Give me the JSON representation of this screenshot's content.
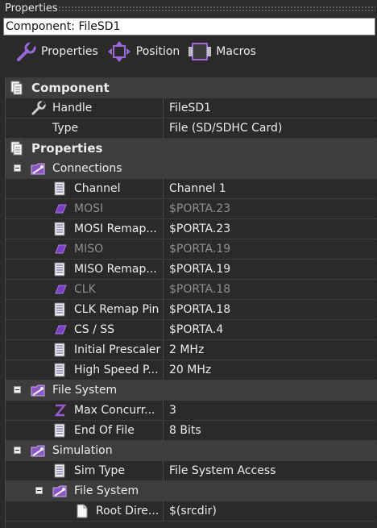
{
  "panel": {
    "title": "Properties"
  },
  "component_field": {
    "text": "Component: FileSD1"
  },
  "toolbar": {
    "properties_label": "Properties",
    "position_label": "Position",
    "macros_label": "Macros"
  },
  "sections": {
    "component": {
      "label": "Component",
      "handle": {
        "name": "Handle",
        "value": "FileSD1"
      },
      "type": {
        "name": "Type",
        "value": "File (SD/SDHC Card)"
      }
    },
    "properties": {
      "label": "Properties"
    },
    "connections": {
      "label": "Connections",
      "channel": {
        "name": "Channel",
        "value": "Channel 1"
      },
      "mosi": {
        "name": "MOSI",
        "value": "$PORTA.23"
      },
      "mosi_remap": {
        "name": "MOSI Remap...",
        "value": "$PORTA.23"
      },
      "miso": {
        "name": "MISO",
        "value": "$PORTA.19"
      },
      "miso_remap": {
        "name": "MISO Remap...",
        "value": "$PORTA.19"
      },
      "clk": {
        "name": "CLK",
        "value": "$PORTA.18"
      },
      "clk_remap": {
        "name": "CLK Remap Pin",
        "value": "$PORTA.18"
      },
      "cs_ss": {
        "name": "CS / SS",
        "value": "$PORTA.4"
      },
      "initial_prescaler": {
        "name": "Initial Prescaler",
        "value": "2 MHz"
      },
      "high_speed": {
        "name": "High Speed P...",
        "value": "20 MHz"
      }
    },
    "file_system": {
      "label": "File System",
      "max_concurrent": {
        "name": "Max Concurr...",
        "value": "3"
      },
      "end_of_file": {
        "name": "End Of File",
        "value": "8 Bits"
      }
    },
    "simulation": {
      "label": "Simulation",
      "sim_type": {
        "name": "Sim Type",
        "value": "File System Access"
      },
      "file_system": {
        "label": "File System"
      },
      "root_dir": {
        "name": "Root Dire...",
        "value": "$(srcdir)"
      }
    }
  },
  "colors": {
    "background": "#2a2a2a",
    "category_row": "#3d3d3d",
    "disabled_text": "#8f8f8f",
    "pin_icon": "#7a3ec2",
    "folder_icon": "#8a55c4"
  }
}
